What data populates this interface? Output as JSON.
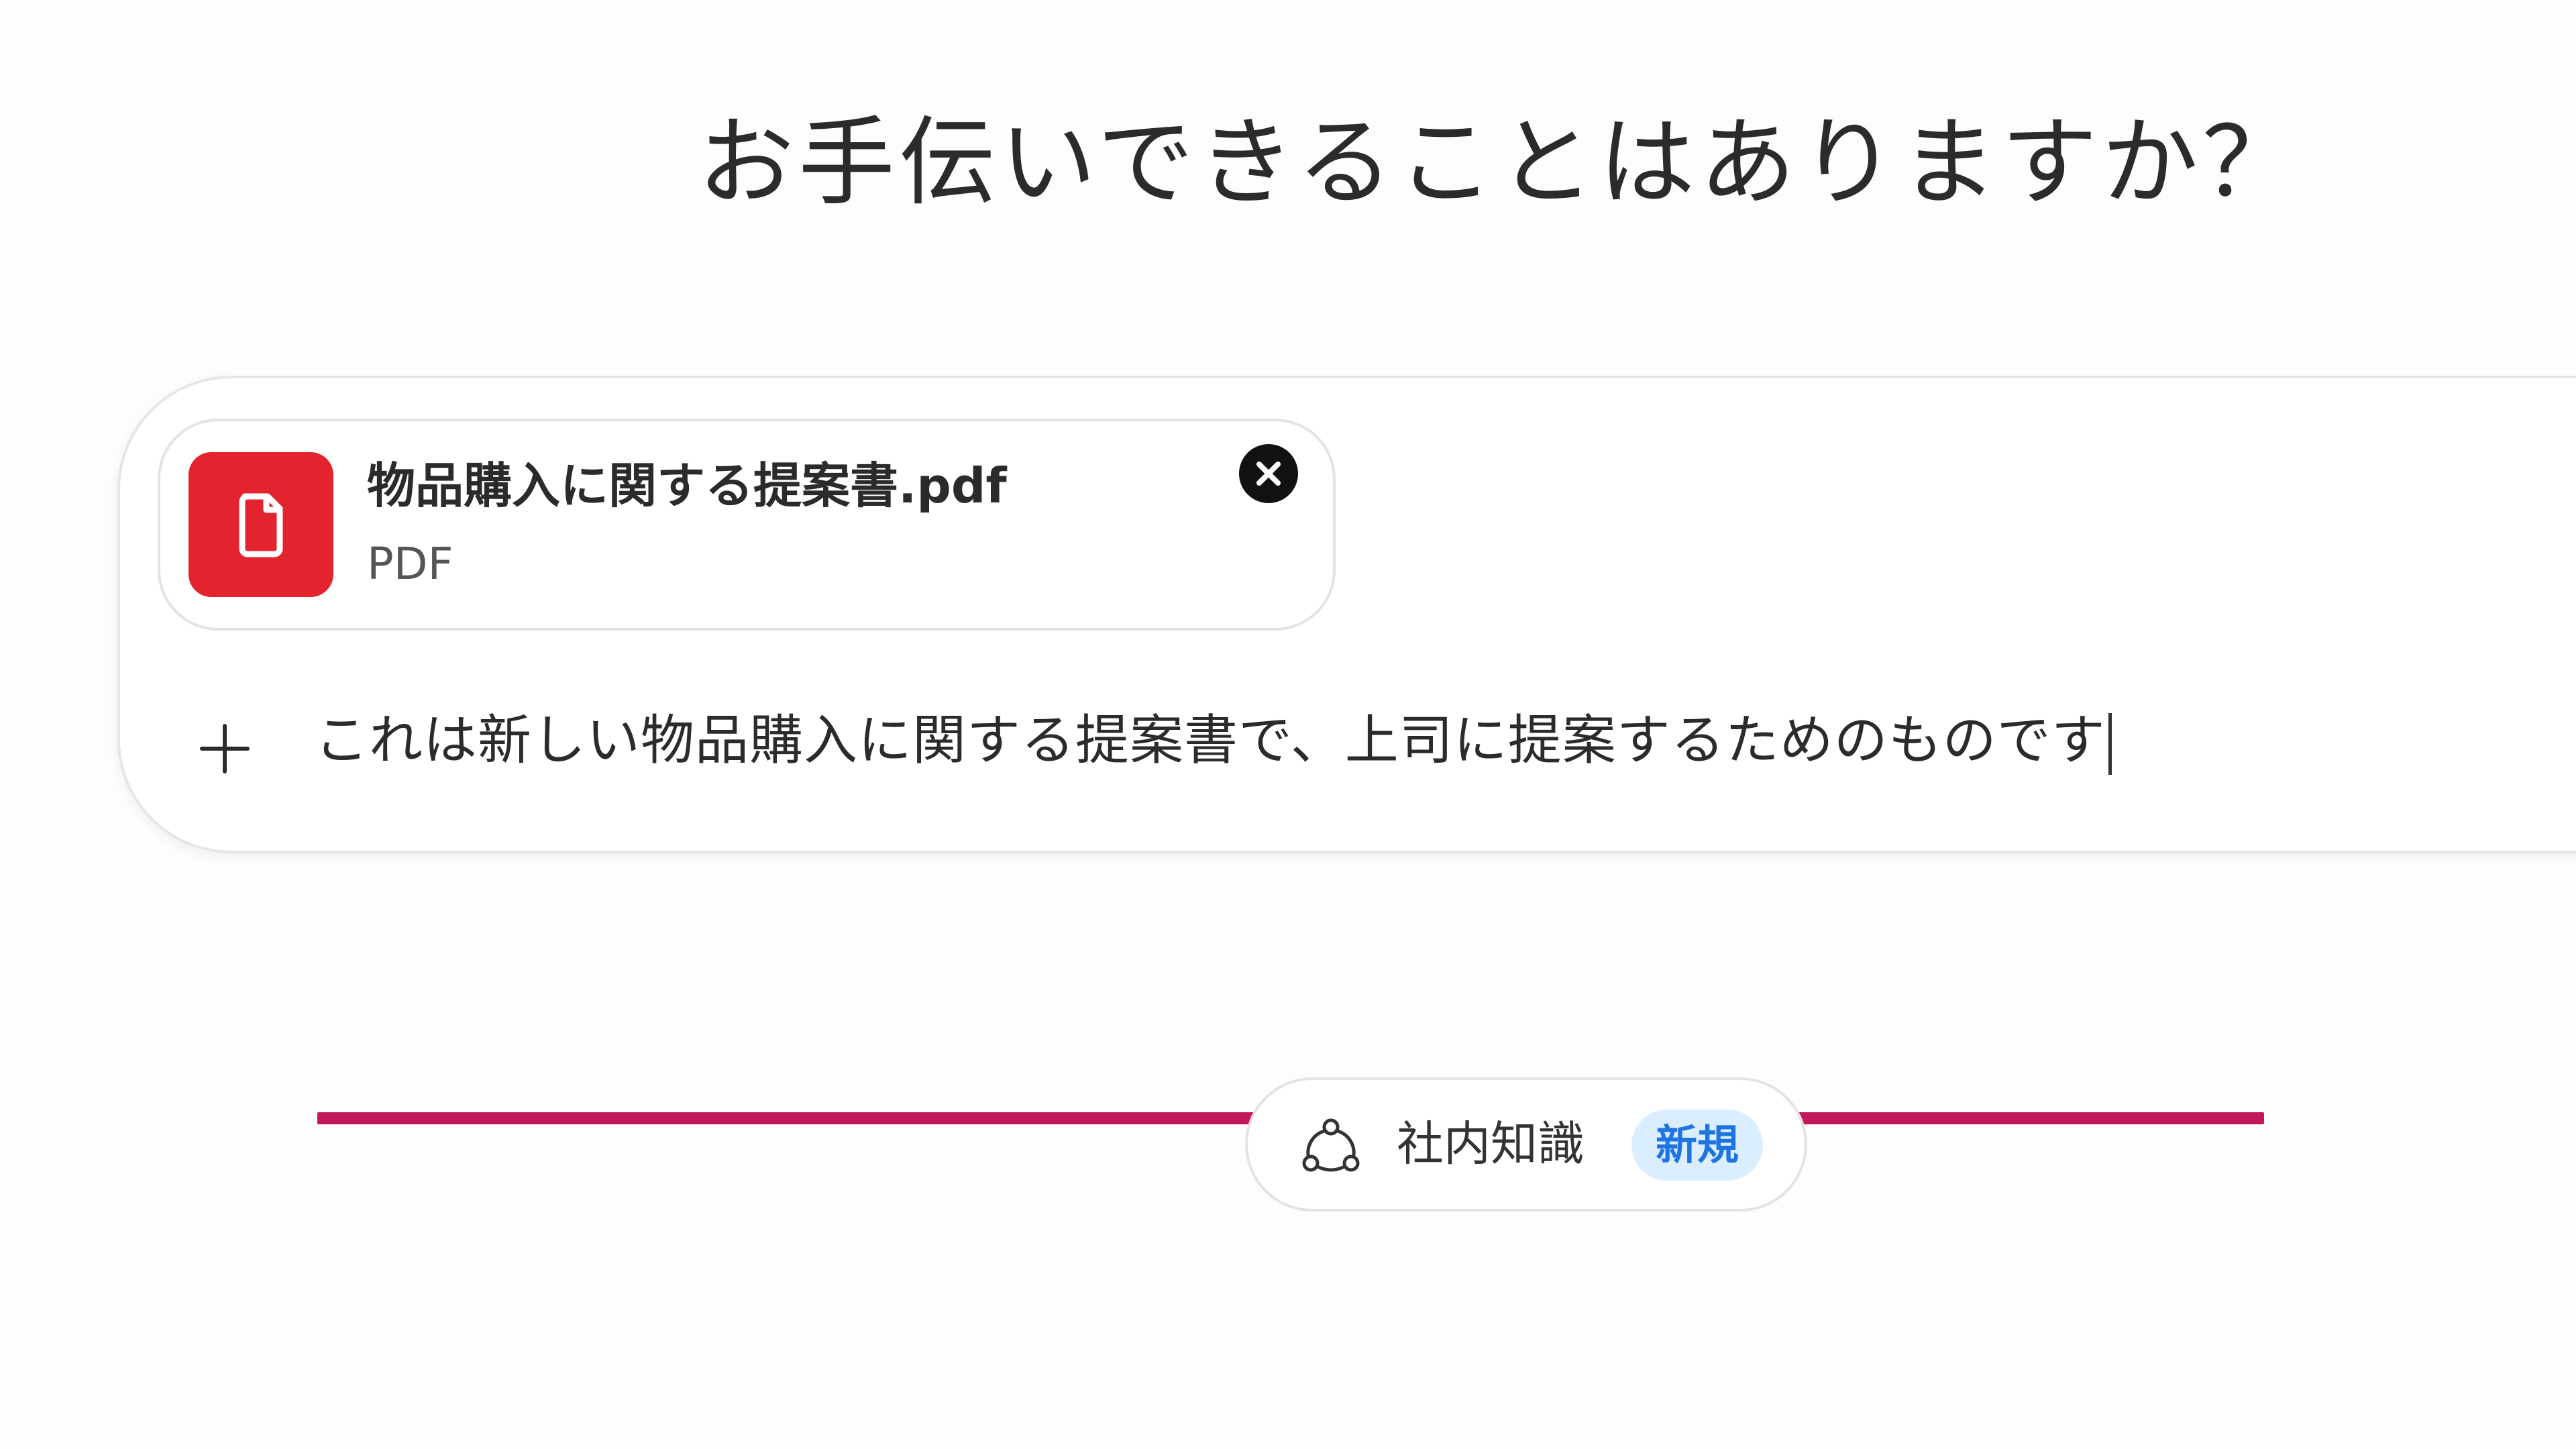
{
  "header": {
    "greeting": "お手伝いできることはありますか？"
  },
  "composer": {
    "attachment": {
      "file_name": "物品購入に関する提案書.pdf",
      "file_type": "PDF",
      "icon": "document-icon",
      "remove_icon": "close-circle-icon",
      "tile_color": "#e3242f"
    },
    "add_icon": "plus-icon",
    "message_value": "これは新しい物品購入に関する提案書で、上司に提案するためのものです",
    "highlight_color": "#c2185b"
  },
  "knowledge": {
    "icon": "knowledge-network-icon",
    "label": "社内知識",
    "badge": "新規",
    "badge_color": "#1e74e0"
  }
}
